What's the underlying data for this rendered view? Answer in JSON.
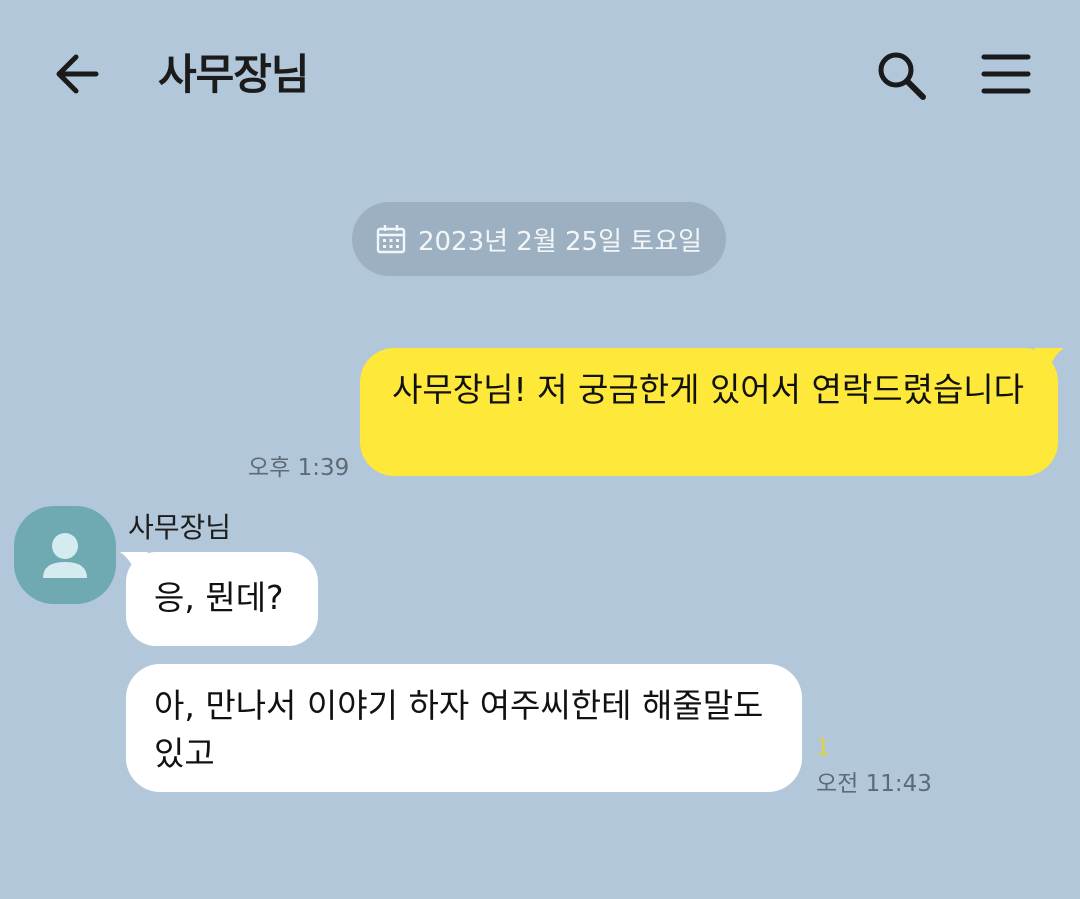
{
  "header": {
    "title": "사무장님",
    "back_icon": "arrow-left-icon",
    "search_icon": "search-icon",
    "menu_icon": "hamburger-menu-icon"
  },
  "date_divider": {
    "icon": "calendar-icon",
    "text": "2023년 2월 25일 토요일"
  },
  "messages": [
    {
      "direction": "outgoing",
      "text": "사무장님! 저 궁금한게 있어서 연락드렸습니다",
      "time": "오후 1:39"
    },
    {
      "direction": "incoming",
      "sender": "사무장님",
      "text": "응, 뭔데?"
    },
    {
      "direction": "incoming",
      "text": "아, 만나서 이야기 하자 여주씨한테 해줄말도 있고",
      "unread_count": "1",
      "time": "오전 11:43"
    }
  ],
  "colors": {
    "background": "#b2c7da",
    "outgoing_bubble": "#fee83a",
    "incoming_bubble": "#ffffff",
    "avatar": "#6fa9b2",
    "date_pill": "#9db0c1",
    "unread_count": "#e0d23a"
  }
}
